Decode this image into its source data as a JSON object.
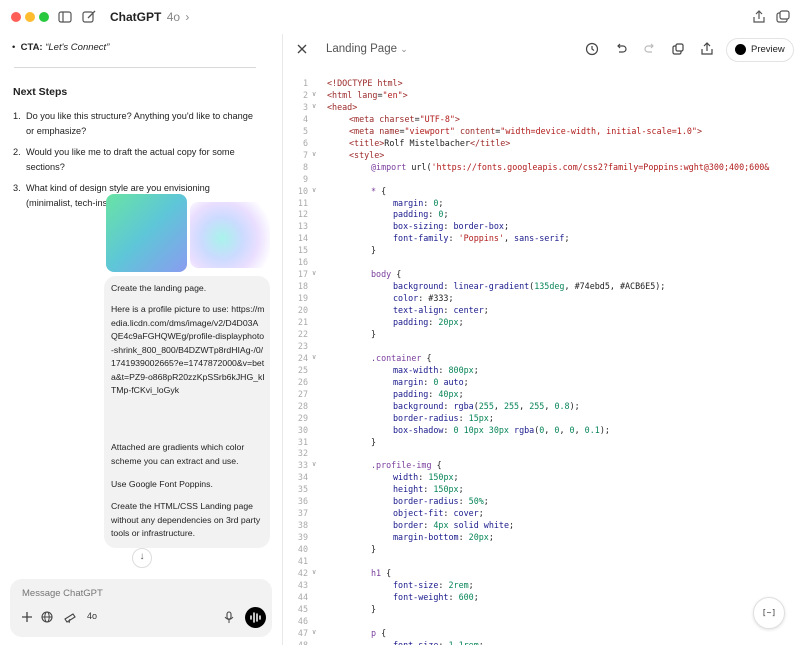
{
  "window": {
    "app_title": "ChatGPT",
    "model": "4o"
  },
  "left": {
    "cta_label": "CTA:",
    "cta_value": "“Let's Connect”",
    "next_steps_heading": "Next Steps",
    "steps": [
      {
        "num": "1.",
        "text": "Do you like this structure? Anything you'd like to change or emphasize?"
      },
      {
        "num": "2.",
        "text": "Would you like me to draft the actual copy for some sections?"
      },
      {
        "num": "3.",
        "text": "What kind of design style are you envisioning (minimalist, tech-ins"
      }
    ],
    "message": {
      "p1": "Create the landing page.",
      "p2": "Here is a profile picture to use: https://media.licdn.com/dms/image/v2/D4D03AQE4c9aFGHQWEg/profile-displayphoto-shrink_800_800/B4DZWTp8rdHIAg-/0/1741939002665?e=1747872000&v=beta&t=PZ9-o868pR20zzKpSSrb6kJHG_kITMp-fCKvi_loGyk",
      "p3": "Attached are gradients which color scheme you can extract and use.",
      "p4": "Use Google Font Poppins.",
      "p5": "Create the HTML/CSS Landing page without any dependencies on 3rd party tools or infrastructure."
    },
    "composer": {
      "placeholder": "Message ChatGPT",
      "model_badge": "4o"
    }
  },
  "canvas": {
    "title": "Landing Page",
    "preview_label": "Preview",
    "fab_label": "[~]",
    "code_lines": [
      {
        "n": "1",
        "fold": "",
        "indent": 0,
        "tokens": [
          [
            "t-tag",
            "<!DOCTYPE html>"
          ]
        ]
      },
      {
        "n": "2",
        "fold": "v",
        "indent": 0,
        "tokens": [
          [
            "t-tag",
            "<html "
          ],
          [
            "t-attr",
            "lang"
          ],
          [
            "t-plain",
            "="
          ],
          [
            "t-str",
            "\"en\""
          ],
          [
            "t-tag",
            ">"
          ]
        ]
      },
      {
        "n": "3",
        "fold": "v",
        "indent": 0,
        "tokens": [
          [
            "t-tag",
            "<head>"
          ]
        ]
      },
      {
        "n": "4",
        "fold": "",
        "indent": 1,
        "tokens": [
          [
            "t-tag",
            "<meta "
          ],
          [
            "t-attr",
            "charset"
          ],
          [
            "t-plain",
            "="
          ],
          [
            "t-str",
            "\"UTF-8\""
          ],
          [
            "t-tag",
            ">"
          ]
        ]
      },
      {
        "n": "5",
        "fold": "",
        "indent": 1,
        "tokens": [
          [
            "t-tag",
            "<meta "
          ],
          [
            "t-attr",
            "name"
          ],
          [
            "t-plain",
            "="
          ],
          [
            "t-str",
            "\"viewport\""
          ],
          [
            "t-plain",
            " "
          ],
          [
            "t-attr",
            "content"
          ],
          [
            "t-plain",
            "="
          ],
          [
            "t-str",
            "\"width=device-width, initial-scale=1.0\""
          ],
          [
            "t-tag",
            ">"
          ]
        ]
      },
      {
        "n": "6",
        "fold": "",
        "indent": 1,
        "tokens": [
          [
            "t-tag",
            "<title>"
          ],
          [
            "t-plain",
            "Rolf Mistelbacher"
          ],
          [
            "t-tag",
            "</title>"
          ]
        ]
      },
      {
        "n": "7",
        "fold": "v",
        "indent": 1,
        "tokens": [
          [
            "t-tag",
            "<style>"
          ]
        ]
      },
      {
        "n": "8",
        "fold": "",
        "indent": 2,
        "tokens": [
          [
            "t-at",
            "@import "
          ],
          [
            "t-plain",
            "url("
          ],
          [
            "t-str",
            "'https://fonts.googleapis.com/css2?family=Poppins:wght@300;400;600&"
          ]
        ]
      },
      {
        "n": "9",
        "fold": "",
        "indent": 0,
        "tokens": []
      },
      {
        "n": "10",
        "fold": "v",
        "indent": 2,
        "tokens": [
          [
            "t-sel",
            "* "
          ],
          [
            "t-plain",
            "{"
          ]
        ]
      },
      {
        "n": "11",
        "fold": "",
        "indent": 3,
        "tokens": [
          [
            "t-prop",
            "margin"
          ],
          [
            "t-plain",
            ": "
          ],
          [
            "t-num",
            "0"
          ],
          [
            "t-plain",
            ";"
          ]
        ]
      },
      {
        "n": "12",
        "fold": "",
        "indent": 3,
        "tokens": [
          [
            "t-prop",
            "padding"
          ],
          [
            "t-plain",
            ": "
          ],
          [
            "t-num",
            "0"
          ],
          [
            "t-plain",
            ";"
          ]
        ]
      },
      {
        "n": "13",
        "fold": "",
        "indent": 3,
        "tokens": [
          [
            "t-prop",
            "box-sizing"
          ],
          [
            "t-plain",
            ": "
          ],
          [
            "t-prop",
            "border-box"
          ],
          [
            "t-plain",
            ";"
          ]
        ]
      },
      {
        "n": "14",
        "fold": "",
        "indent": 3,
        "tokens": [
          [
            "t-prop",
            "font-family"
          ],
          [
            "t-plain",
            ": "
          ],
          [
            "t-str",
            "'Poppins'"
          ],
          [
            "t-plain",
            ", "
          ],
          [
            "t-prop",
            "sans-serif"
          ],
          [
            "t-plain",
            ";"
          ]
        ]
      },
      {
        "n": "15",
        "fold": "",
        "indent": 2,
        "tokens": [
          [
            "t-plain",
            "}"
          ]
        ]
      },
      {
        "n": "16",
        "fold": "",
        "indent": 0,
        "tokens": []
      },
      {
        "n": "17",
        "fold": "v",
        "indent": 2,
        "tokens": [
          [
            "t-sel",
            "body "
          ],
          [
            "t-plain",
            "{"
          ]
        ]
      },
      {
        "n": "18",
        "fold": "",
        "indent": 3,
        "tokens": [
          [
            "t-prop",
            "background"
          ],
          [
            "t-plain",
            ": "
          ],
          [
            "t-prop",
            "linear-gradient"
          ],
          [
            "t-plain",
            "("
          ],
          [
            "t-num",
            "135deg"
          ],
          [
            "t-plain",
            ", "
          ],
          [
            "t-plain",
            "#74ebd5"
          ],
          [
            "t-plain",
            ", "
          ],
          [
            "t-plain",
            "#ACB6E5"
          ],
          [
            "t-plain",
            ");"
          ]
        ]
      },
      {
        "n": "19",
        "fold": "",
        "indent": 3,
        "tokens": [
          [
            "t-prop",
            "color"
          ],
          [
            "t-plain",
            ": #333;"
          ]
        ]
      },
      {
        "n": "20",
        "fold": "",
        "indent": 3,
        "tokens": [
          [
            "t-prop",
            "text-align"
          ],
          [
            "t-plain",
            ": "
          ],
          [
            "t-prop",
            "center"
          ],
          [
            "t-plain",
            ";"
          ]
        ]
      },
      {
        "n": "21",
        "fold": "",
        "indent": 3,
        "tokens": [
          [
            "t-prop",
            "padding"
          ],
          [
            "t-plain",
            ": "
          ],
          [
            "t-num",
            "20px"
          ],
          [
            "t-plain",
            ";"
          ]
        ]
      },
      {
        "n": "22",
        "fold": "",
        "indent": 2,
        "tokens": [
          [
            "t-plain",
            "}"
          ]
        ]
      },
      {
        "n": "23",
        "fold": "",
        "indent": 0,
        "tokens": []
      },
      {
        "n": "24",
        "fold": "v",
        "indent": 2,
        "tokens": [
          [
            "t-sel",
            ".container "
          ],
          [
            "t-plain",
            "{"
          ]
        ]
      },
      {
        "n": "25",
        "fold": "",
        "indent": 3,
        "tokens": [
          [
            "t-prop",
            "max-width"
          ],
          [
            "t-plain",
            ": "
          ],
          [
            "t-num",
            "800px"
          ],
          [
            "t-plain",
            ";"
          ]
        ]
      },
      {
        "n": "26",
        "fold": "",
        "indent": 3,
        "tokens": [
          [
            "t-prop",
            "margin"
          ],
          [
            "t-plain",
            ": "
          ],
          [
            "t-num",
            "0"
          ],
          [
            "t-plain",
            " "
          ],
          [
            "t-prop",
            "auto"
          ],
          [
            "t-plain",
            ";"
          ]
        ]
      },
      {
        "n": "27",
        "fold": "",
        "indent": 3,
        "tokens": [
          [
            "t-prop",
            "padding"
          ],
          [
            "t-plain",
            ": "
          ],
          [
            "t-num",
            "40px"
          ],
          [
            "t-plain",
            ";"
          ]
        ]
      },
      {
        "n": "28",
        "fold": "",
        "indent": 3,
        "tokens": [
          [
            "t-prop",
            "background"
          ],
          [
            "t-plain",
            ": "
          ],
          [
            "t-prop",
            "rgba"
          ],
          [
            "t-plain",
            "("
          ],
          [
            "t-num",
            "255"
          ],
          [
            "t-plain",
            ", "
          ],
          [
            "t-num",
            "255"
          ],
          [
            "t-plain",
            ", "
          ],
          [
            "t-num",
            "255"
          ],
          [
            "t-plain",
            ", "
          ],
          [
            "t-num",
            "0.8"
          ],
          [
            "t-plain",
            ");"
          ]
        ]
      },
      {
        "n": "29",
        "fold": "",
        "indent": 3,
        "tokens": [
          [
            "t-prop",
            "border-radius"
          ],
          [
            "t-plain",
            ": "
          ],
          [
            "t-num",
            "15px"
          ],
          [
            "t-plain",
            ";"
          ]
        ]
      },
      {
        "n": "30",
        "fold": "",
        "indent": 3,
        "tokens": [
          [
            "t-prop",
            "box-shadow"
          ],
          [
            "t-plain",
            ": "
          ],
          [
            "t-num",
            "0 10px 30px "
          ],
          [
            "t-prop",
            "rgba"
          ],
          [
            "t-plain",
            "("
          ],
          [
            "t-num",
            "0"
          ],
          [
            "t-plain",
            ", "
          ],
          [
            "t-num",
            "0"
          ],
          [
            "t-plain",
            ", "
          ],
          [
            "t-num",
            "0"
          ],
          [
            "t-plain",
            ", "
          ],
          [
            "t-num",
            "0.1"
          ],
          [
            "t-plain",
            ");"
          ]
        ]
      },
      {
        "n": "31",
        "fold": "",
        "indent": 2,
        "tokens": [
          [
            "t-plain",
            "}"
          ]
        ]
      },
      {
        "n": "32",
        "fold": "",
        "indent": 0,
        "tokens": []
      },
      {
        "n": "33",
        "fold": "v",
        "indent": 2,
        "tokens": [
          [
            "t-sel",
            ".profile-img "
          ],
          [
            "t-plain",
            "{"
          ]
        ]
      },
      {
        "n": "34",
        "fold": "",
        "indent": 3,
        "tokens": [
          [
            "t-prop",
            "width"
          ],
          [
            "t-plain",
            ": "
          ],
          [
            "t-num",
            "150px"
          ],
          [
            "t-plain",
            ";"
          ]
        ]
      },
      {
        "n": "35",
        "fold": "",
        "indent": 3,
        "tokens": [
          [
            "t-prop",
            "height"
          ],
          [
            "t-plain",
            ": "
          ],
          [
            "t-num",
            "150px"
          ],
          [
            "t-plain",
            ";"
          ]
        ]
      },
      {
        "n": "36",
        "fold": "",
        "indent": 3,
        "tokens": [
          [
            "t-prop",
            "border-radius"
          ],
          [
            "t-plain",
            ": "
          ],
          [
            "t-num",
            "50%"
          ],
          [
            "t-plain",
            ";"
          ]
        ]
      },
      {
        "n": "37",
        "fold": "",
        "indent": 3,
        "tokens": [
          [
            "t-prop",
            "object-fit"
          ],
          [
            "t-plain",
            ": "
          ],
          [
            "t-prop",
            "cover"
          ],
          [
            "t-plain",
            ";"
          ]
        ]
      },
      {
        "n": "38",
        "fold": "",
        "indent": 3,
        "tokens": [
          [
            "t-prop",
            "border"
          ],
          [
            "t-plain",
            ": "
          ],
          [
            "t-num",
            "4px"
          ],
          [
            "t-plain",
            " "
          ],
          [
            "t-prop",
            "solid white"
          ],
          [
            "t-plain",
            ";"
          ]
        ]
      },
      {
        "n": "39",
        "fold": "",
        "indent": 3,
        "tokens": [
          [
            "t-prop",
            "margin-bottom"
          ],
          [
            "t-plain",
            ": "
          ],
          [
            "t-num",
            "20px"
          ],
          [
            "t-plain",
            ";"
          ]
        ]
      },
      {
        "n": "40",
        "fold": "",
        "indent": 2,
        "tokens": [
          [
            "t-plain",
            "}"
          ]
        ]
      },
      {
        "n": "41",
        "fold": "",
        "indent": 0,
        "tokens": []
      },
      {
        "n": "42",
        "fold": "v",
        "indent": 2,
        "tokens": [
          [
            "t-sel",
            "h1 "
          ],
          [
            "t-plain",
            "{"
          ]
        ]
      },
      {
        "n": "43",
        "fold": "",
        "indent": 3,
        "tokens": [
          [
            "t-prop",
            "font-size"
          ],
          [
            "t-plain",
            ": "
          ],
          [
            "t-num",
            "2rem"
          ],
          [
            "t-plain",
            ";"
          ]
        ]
      },
      {
        "n": "44",
        "fold": "",
        "indent": 3,
        "tokens": [
          [
            "t-prop",
            "font-weight"
          ],
          [
            "t-plain",
            ": "
          ],
          [
            "t-num",
            "600"
          ],
          [
            "t-plain",
            ";"
          ]
        ]
      },
      {
        "n": "45",
        "fold": "",
        "indent": 2,
        "tokens": [
          [
            "t-plain",
            "}"
          ]
        ]
      },
      {
        "n": "46",
        "fold": "",
        "indent": 0,
        "tokens": []
      },
      {
        "n": "47",
        "fold": "v",
        "indent": 2,
        "tokens": [
          [
            "t-sel",
            "p "
          ],
          [
            "t-plain",
            "{"
          ]
        ]
      },
      {
        "n": "48",
        "fold": "",
        "indent": 3,
        "tokens": [
          [
            "t-prop",
            "font-size"
          ],
          [
            "t-plain",
            ": "
          ],
          [
            "t-num",
            "1.1rem"
          ],
          [
            "t-plain",
            ";"
          ]
        ]
      }
    ]
  }
}
